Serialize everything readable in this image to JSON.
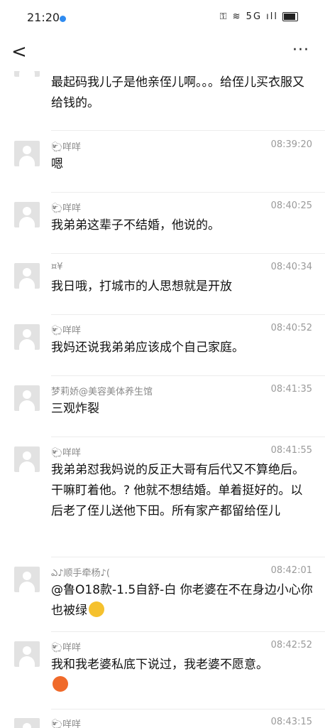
{
  "status_bar": {
    "time": "21:20",
    "icons": "⚿ ≋ 5G ıll"
  },
  "nav": {
    "back": "<",
    "more": "···"
  },
  "messages": [
    {
      "name": "",
      "time": "",
      "text": "最起码我儿子是他亲侄儿啊。。。给侄儿买衣服又给钱的。"
    },
    {
      "name": "🐑咩咩",
      "time": "08:39:20",
      "text": "嗯"
    },
    {
      "name": "🐑咩咩",
      "time": "08:40:25",
      "text": "我弟弟这辈子不结婚，他说的。"
    },
    {
      "name": "¤¥",
      "time": "08:40:34",
      "text": "我日哦，打城市的人思想就是开放"
    },
    {
      "name": "🐑咩咩",
      "time": "08:40:52",
      "text": "我妈还说我弟弟应该成个自己家庭。"
    },
    {
      "name": "梦莉娇@美容美体养生馆",
      "time": "08:41:35",
      "text": "三观炸裂"
    },
    {
      "name": "🐑咩咩",
      "time": "08:41:55",
      "text": "我弟弟怼我妈说的反正大哥有后代又不算绝后。干嘛盯着他。? 他就不想结婚。单着挺好的。以后老了侄儿送他下田。所有家产都留给侄儿"
    },
    {
      "name": "ఎ♪顺手牵杨♪(",
      "time": "08:42:01",
      "text": "@鲁O18款-1.5自舒-白 你老婆在不在身边小心你也被绿",
      "emoji": "laughing-crying-emoji"
    },
    {
      "name": "🐑咩咩",
      "time": "08:42:52",
      "text": "我和我老婆私底下说过，我老婆不愿意。",
      "emoji": "angry-emoji"
    },
    {
      "name": "🐑咩咩",
      "time": "08:43:15",
      "text": ""
    }
  ],
  "colors": {
    "emoji_laugh": "#f5c12e",
    "emoji_angry": "#f06a2a"
  }
}
